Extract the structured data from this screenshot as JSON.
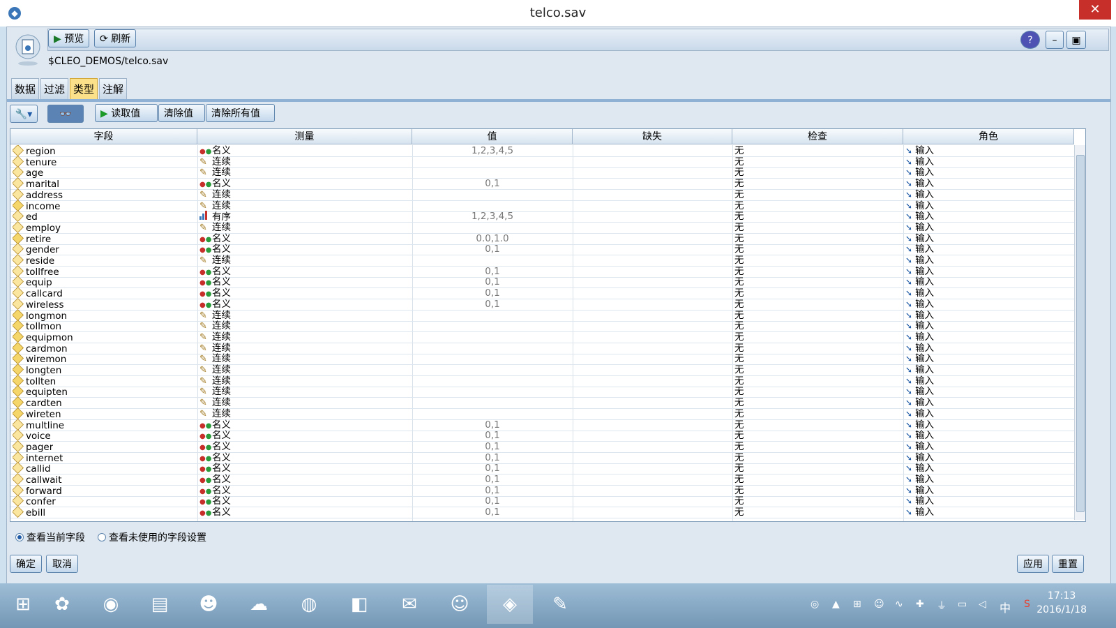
{
  "window": {
    "title": "telco.sav",
    "close_glyph": "✕"
  },
  "toolbar": {
    "preview_label": "预览",
    "refresh_label": "刷新",
    "help_glyph": "?",
    "min_glyph": "–",
    "max_glyph": "▣"
  },
  "path": "$CLEO_DEMOS/telco.sav",
  "tabs": [
    {
      "label": "数据",
      "active": false
    },
    {
      "label": "过滤",
      "active": false
    },
    {
      "label": "类型",
      "active": true
    },
    {
      "label": "注解",
      "active": false
    }
  ],
  "type_toolbar": {
    "read_values": "读取值",
    "clear_values": "清除值",
    "clear_all_values": "清除所有值",
    "wrench_glyph": "🔧",
    "view_glyph": "👓"
  },
  "columns": [
    "字段",
    "测量",
    "值",
    "缺失",
    "检查",
    "角色"
  ],
  "rows": [
    {
      "field": "region",
      "measure": "名义",
      "mtype": "nominal",
      "values": "1,2,3,4,5",
      "missing": "",
      "check": "无",
      "role": "输入",
      "ftype": "string"
    },
    {
      "field": "tenure",
      "measure": "连续",
      "mtype": "continuous",
      "values": "",
      "missing": "",
      "check": "无",
      "role": "输入",
      "ftype": "string"
    },
    {
      "field": "age",
      "measure": "连续",
      "mtype": "continuous",
      "values": "",
      "missing": "",
      "check": "无",
      "role": "输入",
      "ftype": "string"
    },
    {
      "field": "marital",
      "measure": "名义",
      "mtype": "nominal",
      "values": "0,1",
      "missing": "",
      "check": "无",
      "role": "输入",
      "ftype": "string"
    },
    {
      "field": "address",
      "measure": "连续",
      "mtype": "continuous",
      "values": "",
      "missing": "",
      "check": "无",
      "role": "输入",
      "ftype": "string"
    },
    {
      "field": "income",
      "measure": "连续",
      "mtype": "continuous",
      "values": "",
      "missing": "",
      "check": "无",
      "role": "输入",
      "ftype": "real"
    },
    {
      "field": "ed",
      "measure": "有序",
      "mtype": "ordinal",
      "values": "1,2,3,4,5",
      "missing": "",
      "check": "无",
      "role": "输入",
      "ftype": "string"
    },
    {
      "field": "employ",
      "measure": "连续",
      "mtype": "continuous",
      "values": "",
      "missing": "",
      "check": "无",
      "role": "输入",
      "ftype": "string"
    },
    {
      "field": "retire",
      "measure": "名义",
      "mtype": "nominal",
      "values": "0.0,1.0",
      "missing": "",
      "check": "无",
      "role": "输入",
      "ftype": "real"
    },
    {
      "field": "gender",
      "measure": "名义",
      "mtype": "nominal",
      "values": "0,1",
      "missing": "",
      "check": "无",
      "role": "输入",
      "ftype": "string"
    },
    {
      "field": "reside",
      "measure": "连续",
      "mtype": "continuous",
      "values": "",
      "missing": "",
      "check": "无",
      "role": "输入",
      "ftype": "string"
    },
    {
      "field": "tollfree",
      "measure": "名义",
      "mtype": "nominal",
      "values": "0,1",
      "missing": "",
      "check": "无",
      "role": "输入",
      "ftype": "string"
    },
    {
      "field": "equip",
      "measure": "名义",
      "mtype": "nominal",
      "values": "0,1",
      "missing": "",
      "check": "无",
      "role": "输入",
      "ftype": "string"
    },
    {
      "field": "callcard",
      "measure": "名义",
      "mtype": "nominal",
      "values": "0,1",
      "missing": "",
      "check": "无",
      "role": "输入",
      "ftype": "string"
    },
    {
      "field": "wireless",
      "measure": "名义",
      "mtype": "nominal",
      "values": "0,1",
      "missing": "",
      "check": "无",
      "role": "输入",
      "ftype": "string"
    },
    {
      "field": "longmon",
      "measure": "连续",
      "mtype": "continuous",
      "values": "",
      "missing": "",
      "check": "无",
      "role": "输入",
      "ftype": "real"
    },
    {
      "field": "tollmon",
      "measure": "连续",
      "mtype": "continuous",
      "values": "",
      "missing": "",
      "check": "无",
      "role": "输入",
      "ftype": "real"
    },
    {
      "field": "equipmon",
      "measure": "连续",
      "mtype": "continuous",
      "values": "",
      "missing": "",
      "check": "无",
      "role": "输入",
      "ftype": "real"
    },
    {
      "field": "cardmon",
      "measure": "连续",
      "mtype": "continuous",
      "values": "",
      "missing": "",
      "check": "无",
      "role": "输入",
      "ftype": "real"
    },
    {
      "field": "wiremon",
      "measure": "连续",
      "mtype": "continuous",
      "values": "",
      "missing": "",
      "check": "无",
      "role": "输入",
      "ftype": "real"
    },
    {
      "field": "longten",
      "measure": "连续",
      "mtype": "continuous",
      "values": "",
      "missing": "",
      "check": "无",
      "role": "输入",
      "ftype": "real"
    },
    {
      "field": "tollten",
      "measure": "连续",
      "mtype": "continuous",
      "values": "",
      "missing": "",
      "check": "无",
      "role": "输入",
      "ftype": "real"
    },
    {
      "field": "equipten",
      "measure": "连续",
      "mtype": "continuous",
      "values": "",
      "missing": "",
      "check": "无",
      "role": "输入",
      "ftype": "real"
    },
    {
      "field": "cardten",
      "measure": "连续",
      "mtype": "continuous",
      "values": "",
      "missing": "",
      "check": "无",
      "role": "输入",
      "ftype": "real"
    },
    {
      "field": "wireten",
      "measure": "连续",
      "mtype": "continuous",
      "values": "",
      "missing": "",
      "check": "无",
      "role": "输入",
      "ftype": "real"
    },
    {
      "field": "multline",
      "measure": "名义",
      "mtype": "nominal",
      "values": "0,1",
      "missing": "",
      "check": "无",
      "role": "输入",
      "ftype": "string"
    },
    {
      "field": "voice",
      "measure": "名义",
      "mtype": "nominal",
      "values": "0,1",
      "missing": "",
      "check": "无",
      "role": "输入",
      "ftype": "string"
    },
    {
      "field": "pager",
      "measure": "名义",
      "mtype": "nominal",
      "values": "0,1",
      "missing": "",
      "check": "无",
      "role": "输入",
      "ftype": "string"
    },
    {
      "field": "internet",
      "measure": "名义",
      "mtype": "nominal",
      "values": "0,1",
      "missing": "",
      "check": "无",
      "role": "输入",
      "ftype": "string"
    },
    {
      "field": "callid",
      "measure": "名义",
      "mtype": "nominal",
      "values": "0,1",
      "missing": "",
      "check": "无",
      "role": "输入",
      "ftype": "string"
    },
    {
      "field": "callwait",
      "measure": "名义",
      "mtype": "nominal",
      "values": "0,1",
      "missing": "",
      "check": "无",
      "role": "输入",
      "ftype": "string"
    },
    {
      "field": "forward",
      "measure": "名义",
      "mtype": "nominal",
      "values": "0,1",
      "missing": "",
      "check": "无",
      "role": "输入",
      "ftype": "string"
    },
    {
      "field": "confer",
      "measure": "名义",
      "mtype": "nominal",
      "values": "0,1",
      "missing": "",
      "check": "无",
      "role": "输入",
      "ftype": "string"
    },
    {
      "field": "ebill",
      "measure": "名义",
      "mtype": "nominal",
      "values": "0,1",
      "missing": "",
      "check": "无",
      "role": "输入",
      "ftype": "string"
    }
  ],
  "view_options": {
    "current_fields": "查看当前字段",
    "unused_field_settings": "查看未使用的字段设置"
  },
  "footer": {
    "ok": "确定",
    "cancel": "取消",
    "apply": "应用",
    "reset": "重置"
  },
  "taskbar": {
    "time": "17:13",
    "date": "2016/1/18",
    "ime": "中"
  },
  "colors": {
    "accent": "#1e5aa6",
    "tab_active": "#fbe28a",
    "close": "#c7302a"
  }
}
